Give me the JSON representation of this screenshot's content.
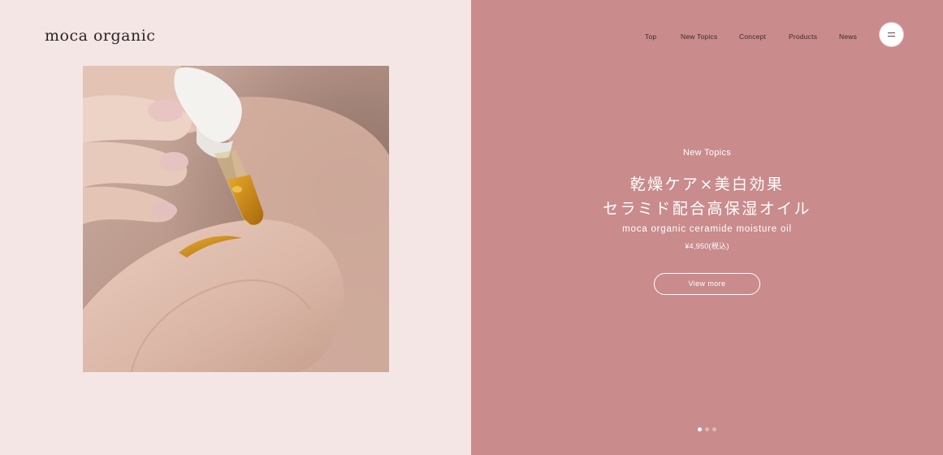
{
  "brand": {
    "logo_text": "moca organic"
  },
  "nav": {
    "items": [
      {
        "label": "Top"
      },
      {
        "label": "New Topics"
      },
      {
        "label": "Concept"
      },
      {
        "label": "Products"
      },
      {
        "label": "News"
      }
    ],
    "menu_icon": "hamburger-menu-icon"
  },
  "hero": {
    "kicker": "New Topics",
    "headline_line1": "乾燥ケア×美白効果",
    "headline_line2": "セラミド配合高保湿オイル",
    "product_name": "moca organic ceramide moisture oil",
    "price": "¥4,950(税込)",
    "cta_label": "View more",
    "image_alt": "Dropper applying serum oil onto the back of a hand",
    "slides_total": 3,
    "slides_active": 1
  },
  "colors": {
    "left_bg": "#f5e6e6",
    "right_bg": "#c98b8c",
    "text_dark": "#2c2424",
    "text_light": "#ffffff"
  }
}
